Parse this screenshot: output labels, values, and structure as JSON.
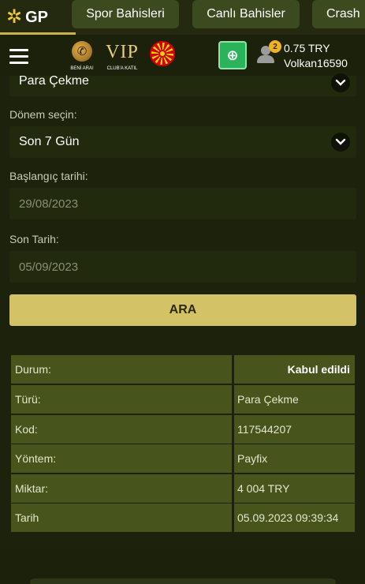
{
  "topnav": {
    "logo_text": "GP",
    "tabs": [
      {
        "label": "Spor Bahisleri"
      },
      {
        "label": "Canlı Bahisler"
      },
      {
        "label": "Crash"
      }
    ]
  },
  "header": {
    "beni_ara_label": "BENİ ARA!",
    "vip_text": "VIP",
    "vip_label": "CLUB'A KATIL",
    "notification_count": "2",
    "balance": "0.75 TRY",
    "username": "Volkan16590"
  },
  "form": {
    "type_value": "Para Çekme",
    "period_label": "Dönem seçin:",
    "period_value": "Son 7 Gün",
    "start_label": "Başlangıç tarihi:",
    "start_value": "29/08/2023",
    "end_label": "Son Tarih:",
    "end_value": "05/09/2023",
    "search_button": "ARA"
  },
  "details": [
    {
      "label": "Durum:",
      "value": "Kabul edildi"
    },
    {
      "label": "Türü:",
      "value": "Para Çekme"
    },
    {
      "label": "Kod:",
      "value": "117544207"
    },
    {
      "label": "Yöntem:",
      "value": "Payfix"
    },
    {
      "label": "Miktar:",
      "value": "4 004 TRY"
    },
    {
      "label": "Tarih",
      "value": "05.09.2023 09:39:34"
    }
  ],
  "colors": {
    "background": "#1c220c",
    "accent_button": "#d4c366",
    "table_cell": "#47541c",
    "cash_green": "#2bb35b",
    "badge": "#f0b21d"
  }
}
